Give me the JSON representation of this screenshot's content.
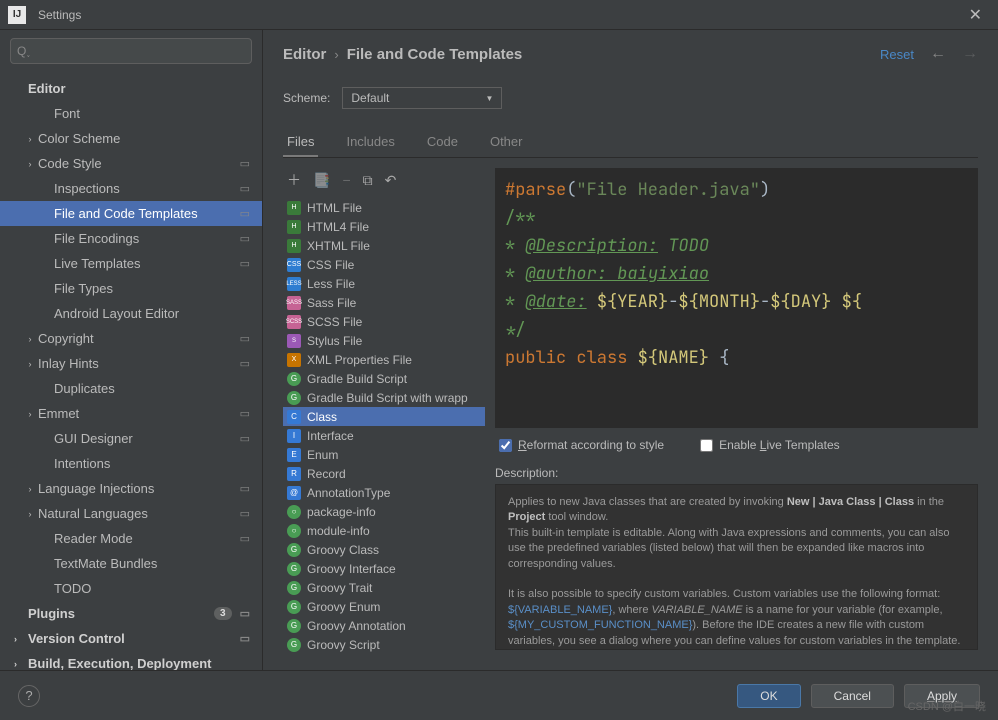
{
  "window": {
    "title": "Settings"
  },
  "search": {
    "placeholder": ""
  },
  "sidebar": {
    "editor_header": "Editor",
    "items": [
      {
        "label": "Font",
        "indent": "child2"
      },
      {
        "label": "Color Scheme",
        "indent": "child1",
        "arrow": "›"
      },
      {
        "label": "Code Style",
        "indent": "child1",
        "arrow": "›",
        "disk": true
      },
      {
        "label": "Inspections",
        "indent": "child2",
        "disk": true
      },
      {
        "label": "File and Code Templates",
        "indent": "child2",
        "disk": true,
        "selected": true
      },
      {
        "label": "File Encodings",
        "indent": "child2",
        "disk": true
      },
      {
        "label": "Live Templates",
        "indent": "child2",
        "disk": true
      },
      {
        "label": "File Types",
        "indent": "child2"
      },
      {
        "label": "Android Layout Editor",
        "indent": "child2"
      },
      {
        "label": "Copyright",
        "indent": "child1",
        "arrow": "›",
        "disk": true
      },
      {
        "label": "Inlay Hints",
        "indent": "child1",
        "arrow": "›",
        "disk": true
      },
      {
        "label": "Duplicates",
        "indent": "child2"
      },
      {
        "label": "Emmet",
        "indent": "child1",
        "arrow": "›",
        "disk": true
      },
      {
        "label": "GUI Designer",
        "indent": "child2",
        "disk": true
      },
      {
        "label": "Intentions",
        "indent": "child2"
      },
      {
        "label": "Language Injections",
        "indent": "child1",
        "arrow": "›",
        "disk": true
      },
      {
        "label": "Natural Languages",
        "indent": "child1",
        "arrow": "›",
        "disk": true
      },
      {
        "label": "Reader Mode",
        "indent": "child2",
        "disk": true
      },
      {
        "label": "TextMate Bundles",
        "indent": "child2"
      },
      {
        "label": "TODO",
        "indent": "child2"
      }
    ],
    "plugins": "Plugins",
    "plugins_badge": "3",
    "version_control": "Version Control",
    "build": "Build, Execution, Deployment"
  },
  "breadcrumb": {
    "root": "Editor",
    "current": "File and Code Templates",
    "reset": "Reset"
  },
  "scheme": {
    "label": "Scheme:",
    "value": "Default"
  },
  "tabs": [
    {
      "label": "Files",
      "active": true
    },
    {
      "label": "Includes"
    },
    {
      "label": "Code"
    },
    {
      "label": "Other"
    }
  ],
  "filelist": [
    {
      "label": "HTML File",
      "icon": "fi-html",
      "text": "H"
    },
    {
      "label": "HTML4 File",
      "icon": "fi-html",
      "text": "H"
    },
    {
      "label": "XHTML File",
      "icon": "fi-html",
      "text": "H"
    },
    {
      "label": "CSS File",
      "icon": "fi-css",
      "text": "CSS"
    },
    {
      "label": "Less File",
      "icon": "fi-less",
      "text": "LESS"
    },
    {
      "label": "Sass File",
      "icon": "fi-sass",
      "text": "SASS"
    },
    {
      "label": "SCSS File",
      "icon": "fi-sass",
      "text": "SCSS"
    },
    {
      "label": "Stylus File",
      "icon": "fi-styl",
      "text": "S"
    },
    {
      "label": "XML Properties File",
      "icon": "fi-xml",
      "text": "X"
    },
    {
      "label": "Gradle Build Script",
      "icon": "fi-green",
      "text": "G"
    },
    {
      "label": "Gradle Build Script with wrapp",
      "icon": "fi-green",
      "text": "G"
    },
    {
      "label": "Class",
      "icon": "fi-java",
      "text": "C",
      "selected": true
    },
    {
      "label": "Interface",
      "icon": "fi-java",
      "text": "I"
    },
    {
      "label": "Enum",
      "icon": "fi-java",
      "text": "E"
    },
    {
      "label": "Record",
      "icon": "fi-java",
      "text": "R"
    },
    {
      "label": "AnnotationType",
      "icon": "fi-java",
      "text": "@"
    },
    {
      "label": "package-info",
      "icon": "fi-green",
      "text": "○"
    },
    {
      "label": "module-info",
      "icon": "fi-green",
      "text": "○"
    },
    {
      "label": "Groovy Class",
      "icon": "fi-green",
      "text": "G"
    },
    {
      "label": "Groovy Interface",
      "icon": "fi-green",
      "text": "G"
    },
    {
      "label": "Groovy Trait",
      "icon": "fi-green",
      "text": "G"
    },
    {
      "label": "Groovy Enum",
      "icon": "fi-green",
      "text": "G"
    },
    {
      "label": "Groovy Annotation",
      "icon": "fi-green",
      "text": "G"
    },
    {
      "label": "Groovy Script",
      "icon": "fi-green",
      "text": "G"
    }
  ],
  "code": {
    "l1a": "#parse",
    "l1b": "(",
    "l1c": "\"File Header.java\"",
    "l1d": ")",
    "l2": "/**",
    "l3a": "* ",
    "l3b": "@Description:",
    "l3c": " TODO",
    "l4a": "* ",
    "l4b": "@author:",
    "l4c": " baiyixiao",
    "l5a": "* ",
    "l5b": "@date:",
    "l5c": " ",
    "l5d": "${YEAR}",
    "l5e": "-",
    "l5f": "${MONTH}",
    "l5g": "-",
    "l5h": "${DAY}",
    "l5i": " ",
    "l5j": "${",
    "l6": "*/",
    "l7a": "public class ",
    "l7b": "${NAME}",
    "l7c": " {"
  },
  "checks": {
    "reformat_pre": "R",
    "reformat": "eformat according to style",
    "live_pre": "Enable ",
    "live_u": "L",
    "live_post": "ive Templates"
  },
  "desc_label": "Description:",
  "description": {
    "p1a": "Applies to new Java classes that are created by invoking ",
    "p1b": "New | Java Class | Class",
    "p1c": " in the ",
    "p1d": "Project",
    "p1e": " tool window.",
    "p2": "This built-in template is editable. Along with Java expressions and comments, you can also use the predefined variables (listed below) that will then be expanded like macros into corresponding values.",
    "p3a": "It is also possible to specify custom variables. Custom variables use the following format: ",
    "p3b": "${VARIABLE_NAME}",
    "p3c": ", where ",
    "p3d": "VARIABLE_NAME",
    "p3e": " is a name for your variable (for example, ",
    "p3f": "${MY_CUSTOM_FUNCTION_NAME}",
    "p3g": "). Before the IDE creates a new file with custom variables, you see a dialog where you can define values for custom variables in the template."
  },
  "buttons": {
    "ok": "OK",
    "cancel": "Cancel",
    "apply": "Apply"
  },
  "watermark": "CSDN @白一晓"
}
